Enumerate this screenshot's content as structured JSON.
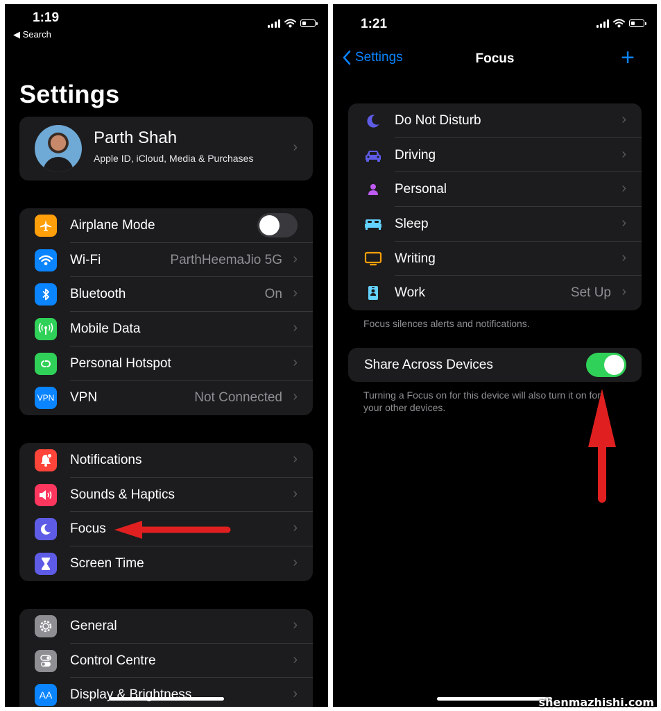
{
  "left_screen": {
    "status": {
      "time": "1:19",
      "back_label": "◀ Search"
    },
    "title": "Settings",
    "profile": {
      "name": "Parth Shah",
      "subtitle": "Apple ID, iCloud, Media & Purchases"
    },
    "connectivity": [
      {
        "label": "Airplane Mode",
        "icon": "airplane-icon",
        "color": "#ff9f0a",
        "toggle": false
      },
      {
        "label": "Wi-Fi",
        "icon": "wifi-icon",
        "color": "#0a84ff",
        "value": "ParthHeemaJio 5G"
      },
      {
        "label": "Bluetooth",
        "icon": "bluetooth-icon",
        "color": "#0a84ff",
        "value": "On"
      },
      {
        "label": "Mobile Data",
        "icon": "antenna-icon",
        "color": "#30d158",
        "value": ""
      },
      {
        "label": "Personal Hotspot",
        "icon": "hotspot-icon",
        "color": "#30d158",
        "value": ""
      },
      {
        "label": "VPN",
        "icon": "vpn-icon",
        "icon_text": "VPN",
        "color": "#0a84ff",
        "value": "Not Connected"
      }
    ],
    "alerts": [
      {
        "label": "Notifications",
        "icon": "bell-icon",
        "color": "#ff453a"
      },
      {
        "label": "Sounds & Haptics",
        "icon": "speaker-icon",
        "color": "#ff375f"
      },
      {
        "label": "Focus",
        "icon": "moon-icon",
        "color": "#5e5ce6"
      },
      {
        "label": "Screen Time",
        "icon": "hourglass-icon",
        "color": "#5e5ce6"
      }
    ],
    "general": [
      {
        "label": "General",
        "icon": "gear-icon",
        "color": "#8e8e93"
      },
      {
        "label": "Control Centre",
        "icon": "switches-icon",
        "color": "#8e8e93"
      },
      {
        "label": "Display & Brightness",
        "icon": "text-size-icon",
        "icon_text": "AA",
        "color": "#0a84ff"
      }
    ]
  },
  "right_screen": {
    "status": {
      "time": "1:21"
    },
    "nav": {
      "back_label": "Settings",
      "title": "Focus",
      "add_label": "+"
    },
    "focus_modes": [
      {
        "label": "Do Not Disturb",
        "icon": "moon-icon",
        "color": "#5e5ce6",
        "value": ""
      },
      {
        "label": "Driving",
        "icon": "car-icon",
        "color": "#5e5ce6",
        "value": ""
      },
      {
        "label": "Personal",
        "icon": "person-icon",
        "color": "#bf5af2",
        "value": ""
      },
      {
        "label": "Sleep",
        "icon": "bed-icon",
        "color": "#64d2ff",
        "value": ""
      },
      {
        "label": "Writing",
        "icon": "monitor-icon",
        "color": "#ff9f0a",
        "value": ""
      },
      {
        "label": "Work",
        "icon": "badge-icon",
        "color": "#64d2ff",
        "value": "Set Up"
      }
    ],
    "focus_footnote": "Focus silences alerts and notifications.",
    "share": {
      "label": "Share Across Devices",
      "enabled": true
    },
    "share_footnote": "Turning a Focus on for this device will also turn it on for your other devices."
  },
  "annotation_color": "#e02020",
  "watermark": "shenmazhishi.com"
}
